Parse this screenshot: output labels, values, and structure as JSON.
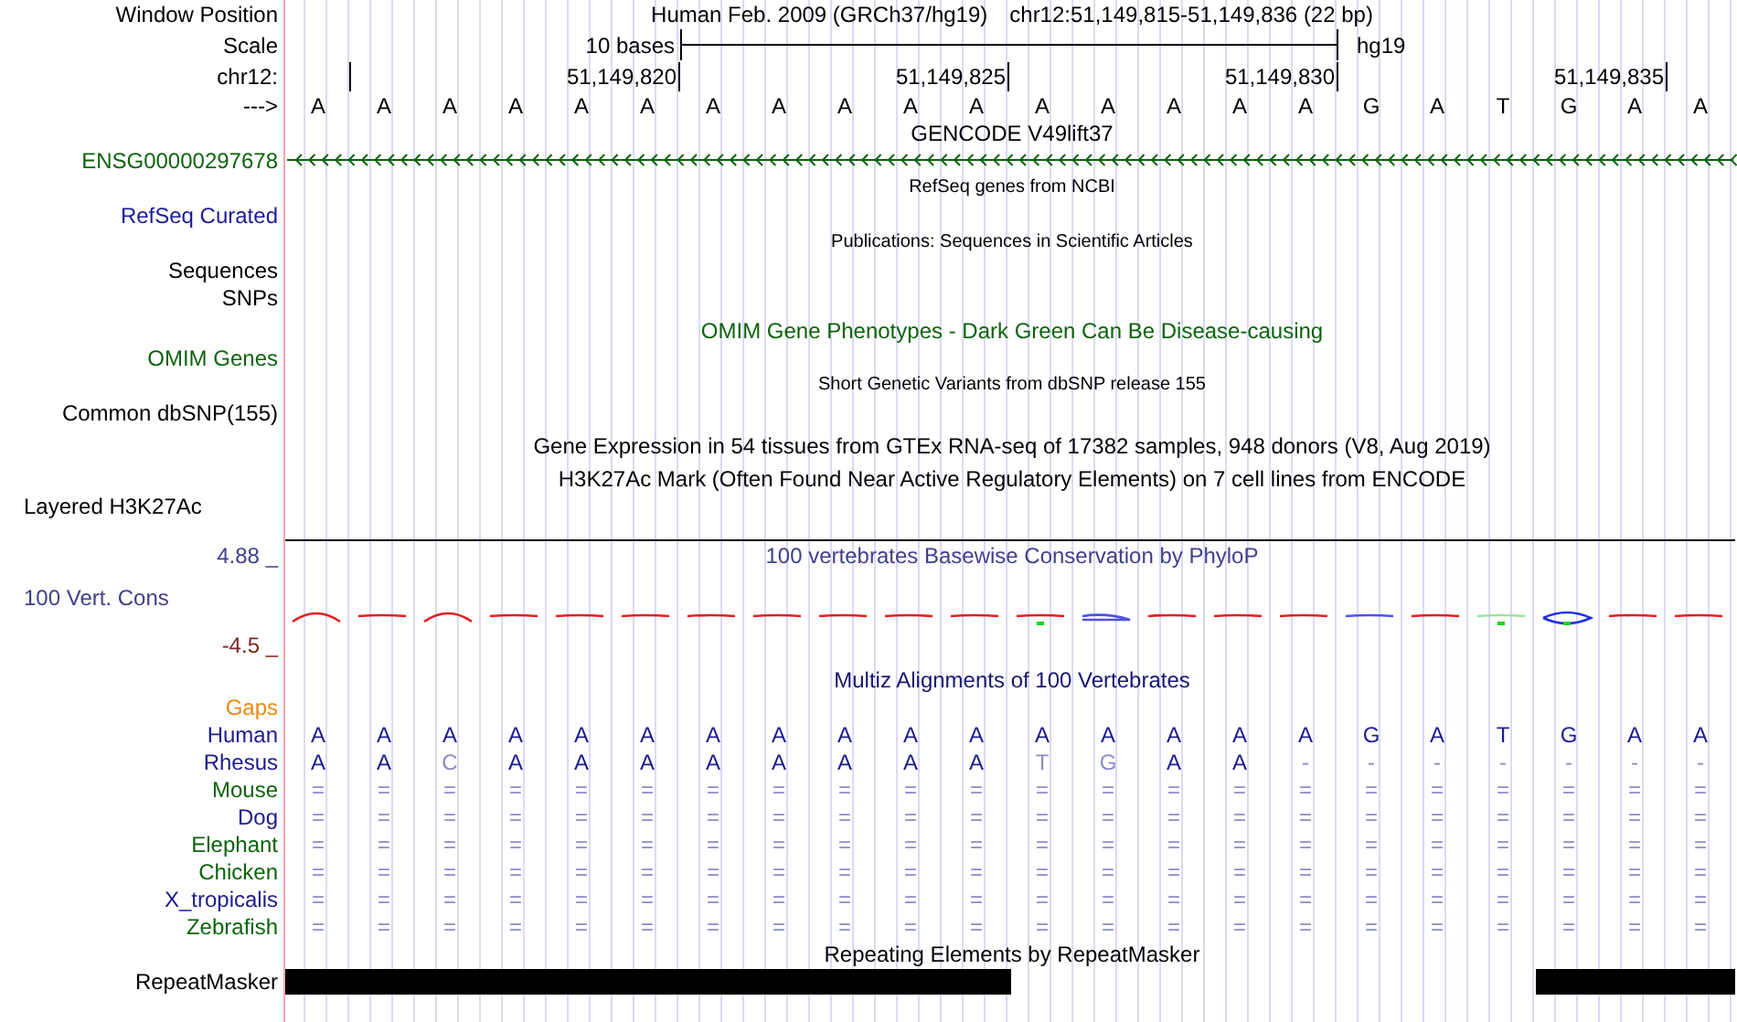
{
  "header": {
    "label": "Window Position",
    "assembly": "Human Feb. 2009 (GRCh37/hg19)",
    "position": "chr12:51,149,815-51,149,836 (22 bp)"
  },
  "scale": {
    "label": "Scale",
    "span": "10 bases",
    "assembly": "hg19"
  },
  "ruler": {
    "label": "chr12:",
    "ticks": [
      "51,149,820",
      "51,149,825",
      "51,149,830",
      "51,149,835"
    ]
  },
  "sequence": {
    "label": "--->",
    "bases": [
      "A",
      "A",
      "A",
      "A",
      "A",
      "A",
      "A",
      "A",
      "A",
      "A",
      "A",
      "A",
      "A",
      "A",
      "A",
      "A",
      "G",
      "A",
      "T",
      "G",
      "A",
      "A"
    ]
  },
  "gencode": {
    "title": "GENCODE V49lift37",
    "gene": "ENSG00000297678"
  },
  "tracks": [
    {
      "kind": "caption",
      "text": "RefSeq genes from NCBI"
    },
    {
      "kind": "label",
      "text": "RefSeq Curated",
      "color": "#1c1c96"
    },
    {
      "kind": "caption",
      "text": "Publications: Sequences in Scientific Articles"
    },
    {
      "kind": "label",
      "text": "Sequences",
      "color": "#000000"
    },
    {
      "kind": "label",
      "text": "SNPs",
      "color": "#000000"
    },
    {
      "kind": "title",
      "text": "OMIM Gene Phenotypes - Dark Green Can Be Disease-causing",
      "color": "#0c640c"
    },
    {
      "kind": "label",
      "text": "OMIM Genes",
      "color": "#0c640c"
    },
    {
      "kind": "caption",
      "text": "Short Genetic Variants from dbSNP release 155"
    },
    {
      "kind": "label",
      "text": "Common dbSNP(155)",
      "color": "#000000"
    },
    {
      "kind": "title",
      "text": "Gene Expression in 54 tissues from GTEx RNA-seq of 17382 samples, 948 donors (V8, Aug 2019)",
      "color": "#000000"
    },
    {
      "kind": "title",
      "text": "H3K27Ac Mark (Often Found Near Active Regulatory Elements) on 7 cell lines from ENCODE",
      "color": "#000000"
    },
    {
      "kind": "side-label",
      "text": "Layered H3K27Ac",
      "color": "#000000"
    }
  ],
  "conservation": {
    "title": "100 vertebrates Basewise Conservation by PhyloP",
    "label": "100 Vert. Cons",
    "max": "4.88 _",
    "min": "-4.5 _"
  },
  "multiz": {
    "title": "Multiz Alignments of 100 Vertebrates",
    "gaps_label": "Gaps",
    "species": [
      {
        "name": "Human",
        "color": "#1c1c8c",
        "bases": [
          {
            "base": "A",
            "match": true
          },
          {
            "base": "A",
            "match": true
          },
          {
            "base": "A",
            "match": true
          },
          {
            "base": "A",
            "match": true
          },
          {
            "base": "A",
            "match": true
          },
          {
            "base": "A",
            "match": true
          },
          {
            "base": "A",
            "match": true
          },
          {
            "base": "A",
            "match": true
          },
          {
            "base": "A",
            "match": true
          },
          {
            "base": "A",
            "match": true
          },
          {
            "base": "A",
            "match": true
          },
          {
            "base": "A",
            "match": true
          },
          {
            "base": "A",
            "match": true
          },
          {
            "base": "A",
            "match": true
          },
          {
            "base": "A",
            "match": true
          },
          {
            "base": "A",
            "match": true
          },
          {
            "base": "G",
            "match": true
          },
          {
            "base": "A",
            "match": true
          },
          {
            "base": "T",
            "match": true
          },
          {
            "base": "G",
            "match": true
          },
          {
            "base": "A",
            "match": true
          },
          {
            "base": "A",
            "match": true
          }
        ]
      },
      {
        "name": "Rhesus",
        "color": "#1c1c8c",
        "bases": [
          {
            "base": "A",
            "match": true
          },
          {
            "base": "A",
            "match": true
          },
          {
            "base": "C",
            "match": false
          },
          {
            "base": "A",
            "match": true
          },
          {
            "base": "A",
            "match": true
          },
          {
            "base": "A",
            "match": true
          },
          {
            "base": "A",
            "match": true
          },
          {
            "base": "A",
            "match": true
          },
          {
            "base": "A",
            "match": true
          },
          {
            "base": "A",
            "match": true
          },
          {
            "base": "A",
            "match": true
          },
          {
            "base": "T",
            "match": false
          },
          {
            "base": "G",
            "match": false
          },
          {
            "base": "A",
            "match": true
          },
          {
            "base": "A",
            "match": true
          },
          {
            "base": "-",
            "match": false
          },
          {
            "base": "-",
            "match": false
          },
          {
            "base": "-",
            "match": false
          },
          {
            "base": "-",
            "match": false
          },
          {
            "base": "-",
            "match": false
          },
          {
            "base": "-",
            "match": false
          },
          {
            "base": "-",
            "match": false
          }
        ]
      },
      {
        "name": "Mouse",
        "color": "#0c640c",
        "bases": [
          {
            "base": "=",
            "match": false
          },
          {
            "base": "=",
            "match": false
          },
          {
            "base": "=",
            "match": false
          },
          {
            "base": "=",
            "match": false
          },
          {
            "base": "=",
            "match": false
          },
          {
            "base": "=",
            "match": false
          },
          {
            "base": "=",
            "match": false
          },
          {
            "base": "=",
            "match": false
          },
          {
            "base": "=",
            "match": false
          },
          {
            "base": "=",
            "match": false
          },
          {
            "base": "=",
            "match": false
          },
          {
            "base": "=",
            "match": false
          },
          {
            "base": "=",
            "match": false
          },
          {
            "base": "=",
            "match": false
          },
          {
            "base": "=",
            "match": false
          },
          {
            "base": "=",
            "match": false
          },
          {
            "base": "=",
            "match": false
          },
          {
            "base": "=",
            "match": false
          },
          {
            "base": "=",
            "match": false
          },
          {
            "base": "=",
            "match": false
          },
          {
            "base": "=",
            "match": false
          },
          {
            "base": "=",
            "match": false
          }
        ]
      },
      {
        "name": "Dog",
        "color": "#1c1c8c",
        "bases": [
          {
            "base": "=",
            "match": false
          },
          {
            "base": "=",
            "match": false
          },
          {
            "base": "=",
            "match": false
          },
          {
            "base": "=",
            "match": false
          },
          {
            "base": "=",
            "match": false
          },
          {
            "base": "=",
            "match": false
          },
          {
            "base": "=",
            "match": false
          },
          {
            "base": "=",
            "match": false
          },
          {
            "base": "=",
            "match": false
          },
          {
            "base": "=",
            "match": false
          },
          {
            "base": "=",
            "match": false
          },
          {
            "base": "=",
            "match": false
          },
          {
            "base": "=",
            "match": false
          },
          {
            "base": "=",
            "match": false
          },
          {
            "base": "=",
            "match": false
          },
          {
            "base": "=",
            "match": false
          },
          {
            "base": "=",
            "match": false
          },
          {
            "base": "=",
            "match": false
          },
          {
            "base": "=",
            "match": false
          },
          {
            "base": "=",
            "match": false
          },
          {
            "base": "=",
            "match": false
          },
          {
            "base": "=",
            "match": false
          }
        ]
      },
      {
        "name": "Elephant",
        "color": "#0c640c",
        "bases": [
          {
            "base": "=",
            "match": false
          },
          {
            "base": "=",
            "match": false
          },
          {
            "base": "=",
            "match": false
          },
          {
            "base": "=",
            "match": false
          },
          {
            "base": "=",
            "match": false
          },
          {
            "base": "=",
            "match": false
          },
          {
            "base": "=",
            "match": false
          },
          {
            "base": "=",
            "match": false
          },
          {
            "base": "=",
            "match": false
          },
          {
            "base": "=",
            "match": false
          },
          {
            "base": "=",
            "match": false
          },
          {
            "base": "=",
            "match": false
          },
          {
            "base": "=",
            "match": false
          },
          {
            "base": "=",
            "match": false
          },
          {
            "base": "=",
            "match": false
          },
          {
            "base": "=",
            "match": false
          },
          {
            "base": "=",
            "match": false
          },
          {
            "base": "=",
            "match": false
          },
          {
            "base": "=",
            "match": false
          },
          {
            "base": "=",
            "match": false
          },
          {
            "base": "=",
            "match": false
          },
          {
            "base": "=",
            "match": false
          }
        ]
      },
      {
        "name": "Chicken",
        "color": "#0c640c",
        "bases": [
          {
            "base": "=",
            "match": false
          },
          {
            "base": "=",
            "match": false
          },
          {
            "base": "=",
            "match": false
          },
          {
            "base": "=",
            "match": false
          },
          {
            "base": "=",
            "match": false
          },
          {
            "base": "=",
            "match": false
          },
          {
            "base": "=",
            "match": false
          },
          {
            "base": "=",
            "match": false
          },
          {
            "base": "=",
            "match": false
          },
          {
            "base": "=",
            "match": false
          },
          {
            "base": "=",
            "match": false
          },
          {
            "base": "=",
            "match": false
          },
          {
            "base": "=",
            "match": false
          },
          {
            "base": "=",
            "match": false
          },
          {
            "base": "=",
            "match": false
          },
          {
            "base": "=",
            "match": false
          },
          {
            "base": "=",
            "match": false
          },
          {
            "base": "=",
            "match": false
          },
          {
            "base": "=",
            "match": false
          },
          {
            "base": "=",
            "match": false
          },
          {
            "base": "=",
            "match": false
          },
          {
            "base": "=",
            "match": false
          }
        ]
      },
      {
        "name": "X_tropicalis",
        "color": "#1c1c8c",
        "bases": [
          {
            "base": "=",
            "match": false
          },
          {
            "base": "=",
            "match": false
          },
          {
            "base": "=",
            "match": false
          },
          {
            "base": "=",
            "match": false
          },
          {
            "base": "=",
            "match": false
          },
          {
            "base": "=",
            "match": false
          },
          {
            "base": "=",
            "match": false
          },
          {
            "base": "=",
            "match": false
          },
          {
            "base": "=",
            "match": false
          },
          {
            "base": "=",
            "match": false
          },
          {
            "base": "=",
            "match": false
          },
          {
            "base": "=",
            "match": false
          },
          {
            "base": "=",
            "match": false
          },
          {
            "base": "=",
            "match": false
          },
          {
            "base": "=",
            "match": false
          },
          {
            "base": "=",
            "match": false
          },
          {
            "base": "=",
            "match": false
          },
          {
            "base": "=",
            "match": false
          },
          {
            "base": "=",
            "match": false
          },
          {
            "base": "=",
            "match": false
          },
          {
            "base": "=",
            "match": false
          },
          {
            "base": "=",
            "match": false
          }
        ]
      },
      {
        "name": "Zebrafish",
        "color": "#0c640c",
        "bases": [
          {
            "base": "=",
            "match": false
          },
          {
            "base": "=",
            "match": false
          },
          {
            "base": "=",
            "match": false
          },
          {
            "base": "=",
            "match": false
          },
          {
            "base": "=",
            "match": false
          },
          {
            "base": "=",
            "match": false
          },
          {
            "base": "=",
            "match": false
          },
          {
            "base": "=",
            "match": false
          },
          {
            "base": "=",
            "match": false
          },
          {
            "base": "=",
            "match": false
          },
          {
            "base": "=",
            "match": false
          },
          {
            "base": "=",
            "match": false
          },
          {
            "base": "=",
            "match": false
          },
          {
            "base": "=",
            "match": false
          },
          {
            "base": "=",
            "match": false
          },
          {
            "base": "=",
            "match": false
          },
          {
            "base": "=",
            "match": false
          },
          {
            "base": "=",
            "match": false
          },
          {
            "base": "=",
            "match": false
          },
          {
            "base": "=",
            "match": false
          },
          {
            "base": "=",
            "match": false
          },
          {
            "base": "=",
            "match": false
          }
        ]
      }
    ]
  },
  "repeatmasker": {
    "title": "Repeating Elements by RepeatMasker",
    "label": "RepeatMasker",
    "masked": [
      true,
      true,
      true,
      true,
      true,
      true,
      true,
      true,
      true,
      true,
      true,
      false,
      false,
      false,
      false,
      false,
      false,
      false,
      false,
      true,
      true,
      true
    ]
  }
}
